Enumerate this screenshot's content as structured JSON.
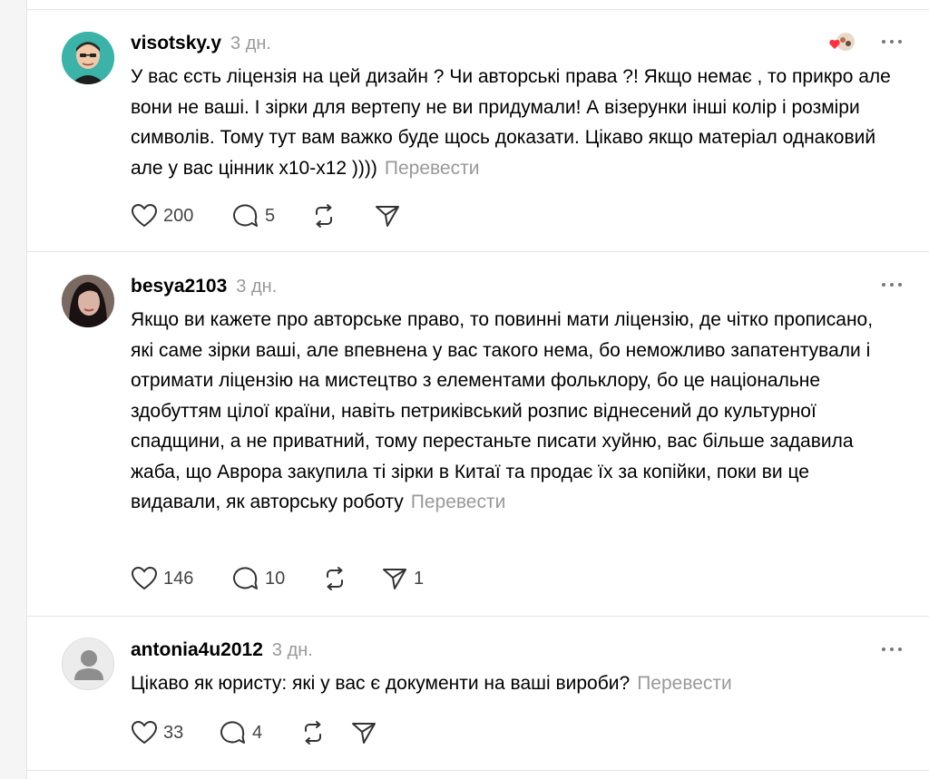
{
  "posts": [
    {
      "username": "visotsky.y",
      "time": "3 дн.",
      "text": "У вас єсть ліцензія на цей дизайн ? Чи авторські права ?! Якщо немає , то прикро але вони не ваші. І зірки для вертепу не ви придумали! А візерунки інші колір і розміри символів. Тому тут вам важко буде щось доказати. Цікаво якщо матеріал однаковий але у вас цінник х10-х12 ))))",
      "translate": "Перевести",
      "likes": "200",
      "replies": "5",
      "reposts": "",
      "shares": ""
    },
    {
      "username": "besya2103",
      "time": "3 дн.",
      "text": "Якщо ви кажете про авторське право, то повинні мати ліцензію, де чітко прописано, які саме зірки ваші, але впевнена у вас такого нема, бо неможливо запатентували і отримати ліцензію на мистецтво з елементами фольклору, бо це національне здобуттям цілої країни, навіть петриківський розпис віднесений до культурної спадщини, а не приватний, тому перестаньте писати хуйню, вас більше задавила жаба, що Аврора закупила ті зірки в Китаї та продає їх за копійки, поки ви це видавали, як авторську роботу",
      "translate": "Перевести",
      "likes": "146",
      "replies": "10",
      "reposts": "",
      "shares": "1"
    },
    {
      "username": "antonia4u2012",
      "time": "3 дн.",
      "text": "Цікаво як юристу: які у вас є документи на ваші вироби?",
      "translate": "Перевести",
      "likes": "33",
      "replies": "4",
      "reposts": "",
      "shares": ""
    }
  ],
  "colors": {
    "muted": "#999999",
    "divider": "#e5e5e5",
    "like_heart": "#ff3040"
  }
}
